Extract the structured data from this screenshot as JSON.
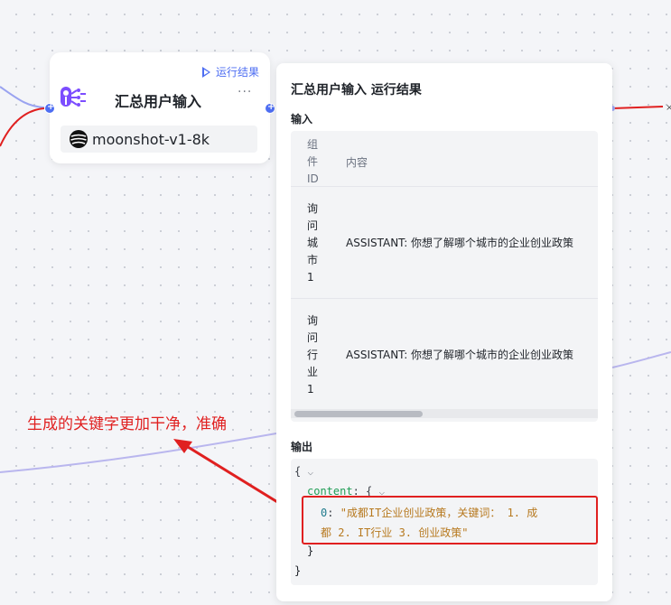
{
  "node": {
    "run_link": "运行结果",
    "title": "汇总用户输入",
    "more": "···",
    "model_name": "moonshot-v1-8k"
  },
  "panel": {
    "title": "汇总用户输入 运行结果",
    "input_label": "输入",
    "output_label": "输出",
    "table": {
      "headers": [
        "组件ID",
        "内容"
      ],
      "rows": [
        {
          "id": "询问城市1",
          "content": "ASSISTANT: 你想了解哪个城市的企业创业政策"
        },
        {
          "id": "询问行业1",
          "content": "ASSISTANT: 你想了解哪个城市的企业创业政策"
        }
      ]
    },
    "output": {
      "open_brace": "{",
      "key": "content",
      "index": "0",
      "value_line1": "\"成都IT企业创业政策，关键词： 1. 成",
      "value_line2": "都 2. IT行业 3. 创业政策\"",
      "inner_close": "}",
      "outer_close": "}"
    }
  },
  "annotation": {
    "text": "生成的关键字更加干净，准确",
    "color": "#e02020"
  },
  "colors": {
    "accent": "#4e6ef2",
    "edge_red": "#e02020",
    "edge_purple": "#b9b6ee"
  }
}
